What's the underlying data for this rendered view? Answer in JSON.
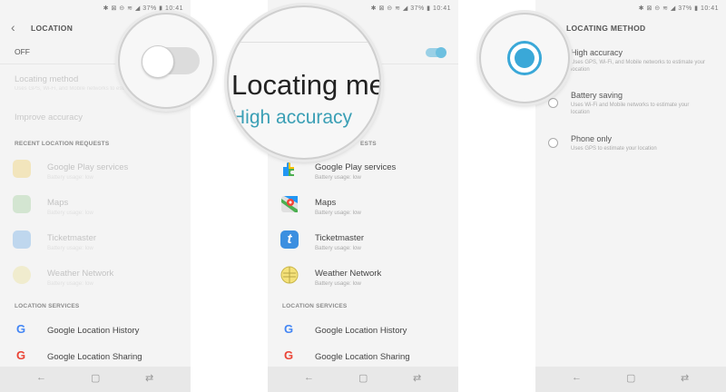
{
  "status": {
    "right": "✱ ⊠ ⊝ ≋ ◢ 37% ▮ 10:41"
  },
  "screen1": {
    "header_title": "LOCATION",
    "off_label": "OFF",
    "locating_method_label": "Locating method",
    "locating_method_sub": "Uses GPS, Wi-Fi, and Mobile networks to estimate your location",
    "improve_accuracy": "Improve accuracy",
    "recent_section": "RECENT LOCATION REQUESTS",
    "services_section": "LOCATION SERVICES"
  },
  "apps": [
    {
      "name": "Google Play services",
      "usage": "Battery usage: low"
    },
    {
      "name": "Maps",
      "usage": "Battery usage: low"
    },
    {
      "name": "Ticketmaster",
      "usage": "Battery usage: low"
    },
    {
      "name": "Weather Network",
      "usage": "Battery usage: low"
    }
  ],
  "services": [
    {
      "name": "Google Location History"
    },
    {
      "name": "Google Location Sharing"
    }
  ],
  "magnifier2": {
    "line1": "Locating me",
    "line2": "High accuracy"
  },
  "screen2": {
    "services_section": "LOCATION SERVICES",
    "recent_section_tail": "ESTS"
  },
  "screen3": {
    "header_title": "LOCATING METHOD",
    "options": [
      {
        "label": "High accuracy",
        "sub": "Uses GPS, Wi-Fi, and Mobile networks to estimate your location"
      },
      {
        "label": "Battery saving",
        "sub": "Uses Wi-Fi and Mobile networks to estimate your location"
      },
      {
        "label": "Phone only",
        "sub": "Uses GPS to estimate your location"
      }
    ]
  },
  "nav": {
    "back": "←",
    "home": "▢",
    "recent": "⇄"
  },
  "colors": {
    "accent": "#3aa8d8",
    "text": "#444444"
  }
}
